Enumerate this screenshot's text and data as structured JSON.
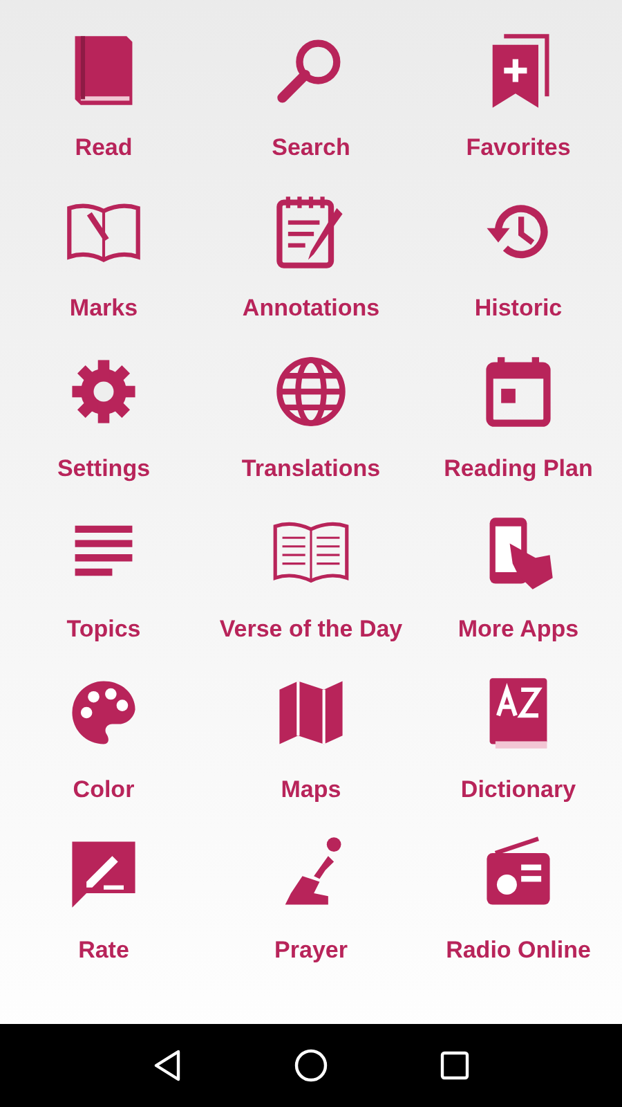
{
  "menu": [
    {
      "label": "Read"
    },
    {
      "label": "Search"
    },
    {
      "label": "Favorites"
    },
    {
      "label": "Marks"
    },
    {
      "label": "Annotations"
    },
    {
      "label": "Historic"
    },
    {
      "label": "Settings"
    },
    {
      "label": "Translations"
    },
    {
      "label": "Reading Plan"
    },
    {
      "label": "Topics"
    },
    {
      "label": "Verse of the Day"
    },
    {
      "label": "More Apps"
    },
    {
      "label": "Color"
    },
    {
      "label": "Maps"
    },
    {
      "label": "Dictionary"
    },
    {
      "label": "Rate"
    },
    {
      "label": "Prayer"
    },
    {
      "label": "Radio Online"
    }
  ]
}
